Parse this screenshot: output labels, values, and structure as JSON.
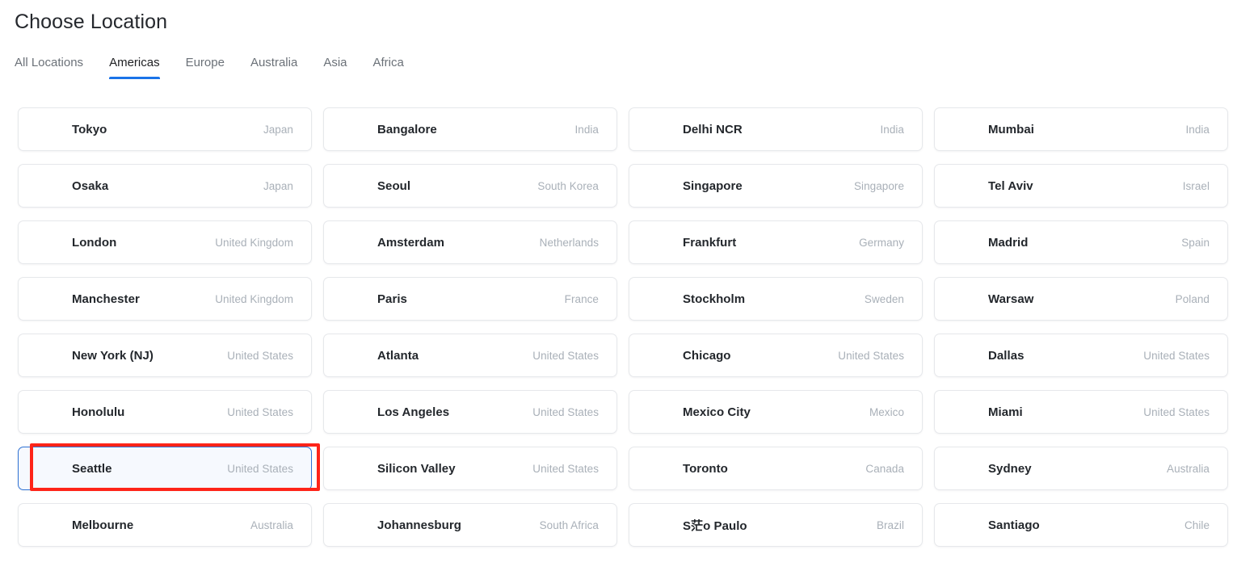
{
  "header": {
    "title": "Choose Location"
  },
  "tabs": [
    {
      "label": "All Locations",
      "active": false
    },
    {
      "label": "Americas",
      "active": true
    },
    {
      "label": "Europe",
      "active": false
    },
    {
      "label": "Australia",
      "active": false
    },
    {
      "label": "Asia",
      "active": false
    },
    {
      "label": "Africa",
      "active": false
    }
  ],
  "colors": {
    "accent": "#1a73e8",
    "selected_border": "#2f72d4",
    "selected_background": "#f6f9fe",
    "annotation": "#fe2419",
    "city_text": "#23272c",
    "country_text": "#a9b0b8",
    "card_border": "#e6e8eb"
  },
  "locations": [
    {
      "city": "Tokyo",
      "country": "Japan",
      "selected": false
    },
    {
      "city": "Bangalore",
      "country": "India",
      "selected": false
    },
    {
      "city": "Delhi NCR",
      "country": "India",
      "selected": false
    },
    {
      "city": "Mumbai",
      "country": "India",
      "selected": false
    },
    {
      "city": "Osaka",
      "country": "Japan",
      "selected": false
    },
    {
      "city": "Seoul",
      "country": "South Korea",
      "selected": false
    },
    {
      "city": "Singapore",
      "country": "Singapore",
      "selected": false
    },
    {
      "city": "Tel Aviv",
      "country": "Israel",
      "selected": false
    },
    {
      "city": "London",
      "country": "United Kingdom",
      "selected": false
    },
    {
      "city": "Amsterdam",
      "country": "Netherlands",
      "selected": false
    },
    {
      "city": "Frankfurt",
      "country": "Germany",
      "selected": false
    },
    {
      "city": "Madrid",
      "country": "Spain",
      "selected": false
    },
    {
      "city": "Manchester",
      "country": "United Kingdom",
      "selected": false
    },
    {
      "city": "Paris",
      "country": "France",
      "selected": false
    },
    {
      "city": "Stockholm",
      "country": "Sweden",
      "selected": false
    },
    {
      "city": "Warsaw",
      "country": "Poland",
      "selected": false
    },
    {
      "city": "New York (NJ)",
      "country": "United States",
      "selected": false
    },
    {
      "city": "Atlanta",
      "country": "United States",
      "selected": false
    },
    {
      "city": "Chicago",
      "country": "United States",
      "selected": false
    },
    {
      "city": "Dallas",
      "country": "United States",
      "selected": false
    },
    {
      "city": "Honolulu",
      "country": "United States",
      "selected": false
    },
    {
      "city": "Los Angeles",
      "country": "United States",
      "selected": false
    },
    {
      "city": "Mexico City",
      "country": "Mexico",
      "selected": false
    },
    {
      "city": "Miami",
      "country": "United States",
      "selected": false
    },
    {
      "city": "Seattle",
      "country": "United States",
      "selected": true
    },
    {
      "city": "Silicon Valley",
      "country": "United States",
      "selected": false
    },
    {
      "city": "Toronto",
      "country": "Canada",
      "selected": false
    },
    {
      "city": "Sydney",
      "country": "Australia",
      "selected": false
    },
    {
      "city": "Melbourne",
      "country": "Australia",
      "selected": false
    },
    {
      "city": "Johannesburg",
      "country": "South Africa",
      "selected": false
    },
    {
      "city": "S茫o Paulo",
      "country": "Brazil",
      "selected": false
    },
    {
      "city": "Santiago",
      "country": "Chile",
      "selected": false
    }
  ],
  "annotation": {
    "target_city": "Seattle",
    "shape": "rectangle"
  }
}
